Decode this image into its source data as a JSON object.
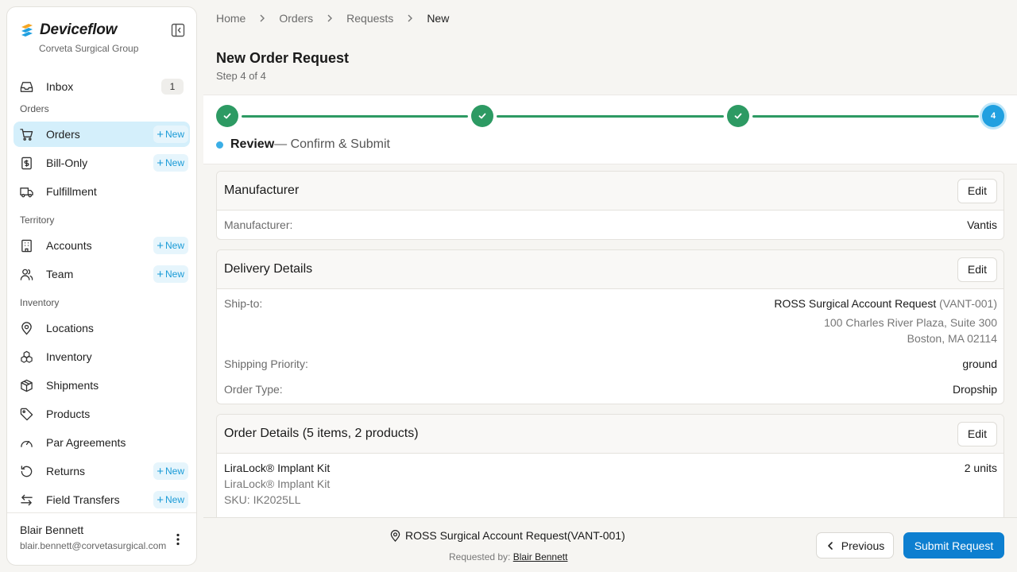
{
  "app": {
    "name": "Deviceflow",
    "org": "Corveta Surgical Group"
  },
  "sidebar": {
    "inbox": {
      "label": "Inbox",
      "count": "1"
    },
    "new_label": "New",
    "sections": {
      "orders": "Orders",
      "territory": "Territory",
      "inventory": "Inventory"
    },
    "items": {
      "orders": "Orders",
      "bill_only": "Bill-Only",
      "fulfillment": "Fulfillment",
      "accounts": "Accounts",
      "team": "Team",
      "locations": "Locations",
      "inventory": "Inventory",
      "shipments": "Shipments",
      "products": "Products",
      "par_agreements": "Par Agreements",
      "returns": "Returns",
      "field_transfers": "Field Transfers"
    },
    "user": {
      "name": "Blair Bennett",
      "email": "blair.bennett@corvetasurgical.com"
    }
  },
  "breadcrumb": [
    "Home",
    "Orders",
    "Requests",
    "New"
  ],
  "page": {
    "title": "New Order Request",
    "step": "Step 4 of 4"
  },
  "stepper": {
    "current_number": "4",
    "stage_name": "Review",
    "stage_desc": "— Confirm & Submit",
    "completed_steps": 3,
    "total_steps": 4
  },
  "manufacturer": {
    "title": "Manufacturer",
    "edit": "Edit",
    "label": "Manufacturer:",
    "value": "Vantis"
  },
  "delivery": {
    "title": "Delivery Details",
    "edit": "Edit",
    "ship_to_label": "Ship-to:",
    "ship_to_name": "ROSS Surgical Account Request",
    "ship_to_code": "(VANT-001)",
    "address_line1": "100 Charles River Plaza, Suite 300",
    "address_line2": "Boston, MA 02114",
    "priority_label": "Shipping Priority:",
    "priority_value": "ground",
    "order_type_label": "Order Type:",
    "order_type_value": "Dropship"
  },
  "order_details": {
    "title": "Order Details (5 items, 2 products)",
    "edit": "Edit",
    "items": [
      {
        "name": "LiraLock® Implant Kit",
        "subtitle": "LiraLock® Implant Kit",
        "sku": "SKU: IK2025LL",
        "qty": "2 units"
      }
    ]
  },
  "footer": {
    "account": "ROSS Surgical Account Request(VANT-001)",
    "requested_by_label": "Requested by:",
    "requested_by_name": "Blair Bennett",
    "previous": "Previous",
    "submit": "Submit Request"
  },
  "colors": {
    "accent": "#0d7fd0",
    "step_complete": "#2d9a63",
    "step_current": "#20a0e0",
    "active_nav_bg": "#d4effb"
  },
  "icons": {
    "brand": "deviceflow-logo-icon",
    "collapse": "sidebar-collapse-icon",
    "inbox": "inbox-icon",
    "orders": "cart-icon",
    "bill_only": "receipt-dollar-icon",
    "fulfillment": "truck-icon",
    "accounts": "building-icon",
    "team": "users-icon",
    "locations": "map-pin-icon",
    "inventory": "boxes-icon",
    "shipments": "package-icon",
    "products": "tag-icon",
    "par_agreements": "gauge-icon",
    "returns": "rotate-ccw-icon",
    "field_transfers": "arrows-left-right-icon",
    "step_done": "check-icon",
    "account": "location-account-icon",
    "previous": "chevron-left-icon"
  }
}
